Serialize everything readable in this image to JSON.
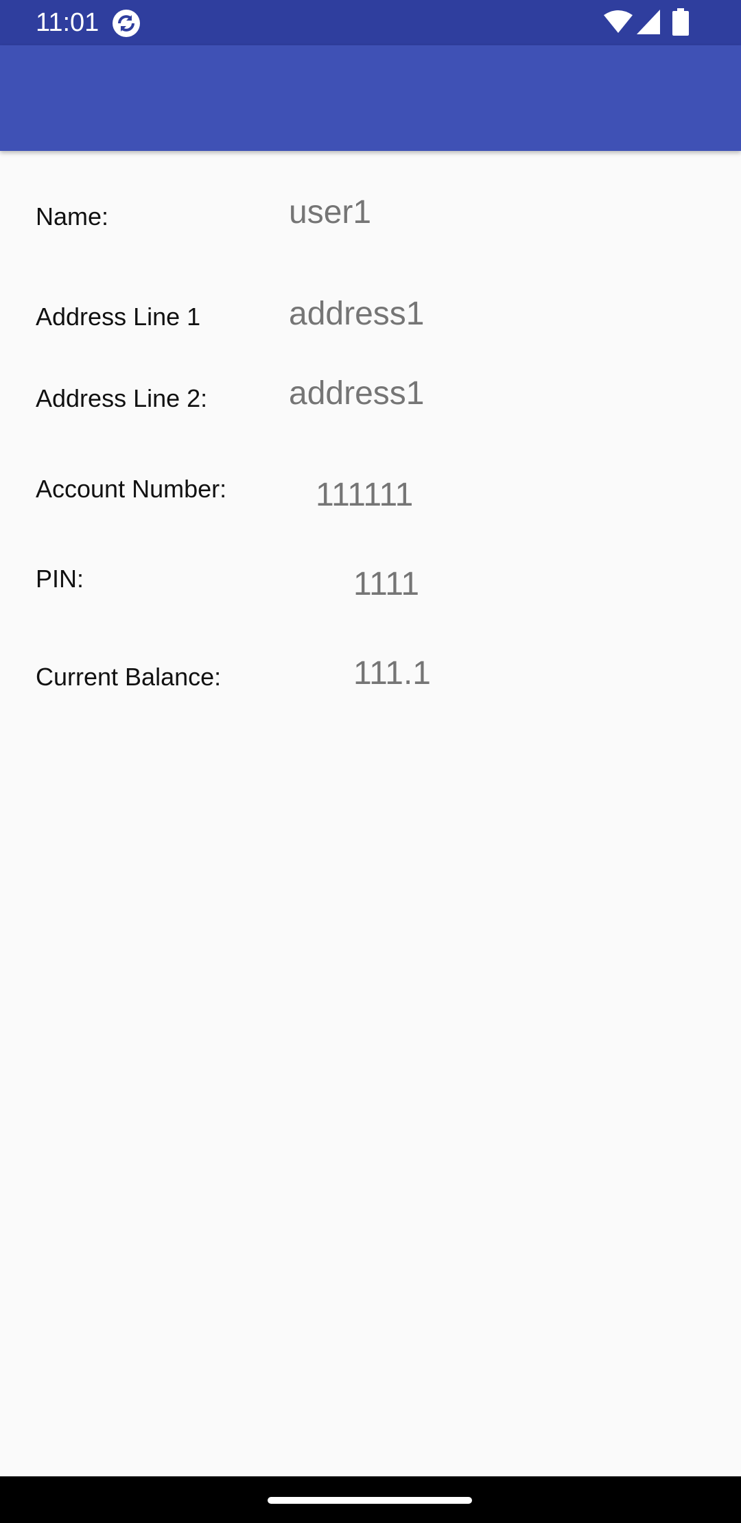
{
  "status_bar": {
    "time": "11:01",
    "icons": [
      "sync-icon",
      "wifi-icon",
      "signal-icon",
      "battery-icon"
    ],
    "background": "#2f3e9e"
  },
  "app_bar": {
    "background": "#3f51b5"
  },
  "details": {
    "name": {
      "label": "Name:",
      "value": "user1"
    },
    "address1": {
      "label": "Address Line 1",
      "value": "address1"
    },
    "address2": {
      "label": "Address Line 2:",
      "value": "address1"
    },
    "account_number": {
      "label": "Account Number:",
      "value": "111111"
    },
    "pin": {
      "label": "PIN:",
      "value": "1111"
    },
    "balance": {
      "label": "Current Balance:",
      "value": "111.1"
    }
  },
  "colors": {
    "label_text": "#111111",
    "value_text": "#757575",
    "page_background": "#fafafa"
  }
}
